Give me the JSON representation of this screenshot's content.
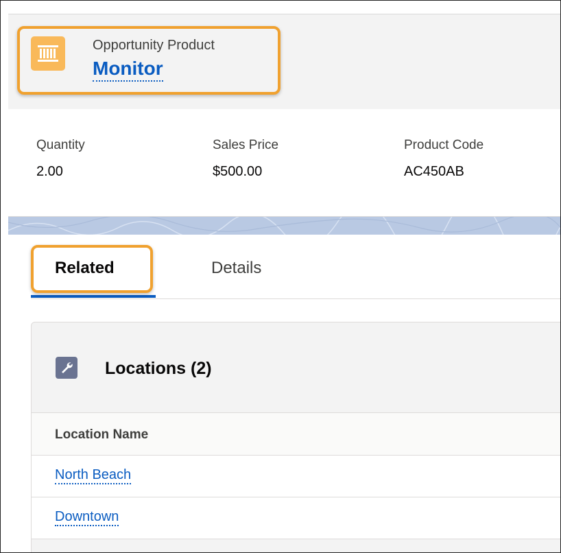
{
  "record": {
    "object_type": "Opportunity Product",
    "name": "Monitor",
    "icon": "product-icon"
  },
  "highlights": [
    {
      "label": "Quantity",
      "value": "2.00"
    },
    {
      "label": "Sales Price",
      "value": "$500.00"
    },
    {
      "label": "Product Code",
      "value": "AC450AB"
    }
  ],
  "tabs": [
    {
      "label": "Related",
      "active": true
    },
    {
      "label": "Details",
      "active": false
    }
  ],
  "related_list": {
    "title": "Locations (2)",
    "icon": "wrench-icon",
    "column_header": "Location Name",
    "rows": [
      "North Beach",
      "Downtown"
    ]
  },
  "colors": {
    "link": "#0a5cc1",
    "highlight_outline": "#f0a12f",
    "product_icon_bg": "#f9b95a",
    "wrench_icon_bg": "#6a7391"
  }
}
